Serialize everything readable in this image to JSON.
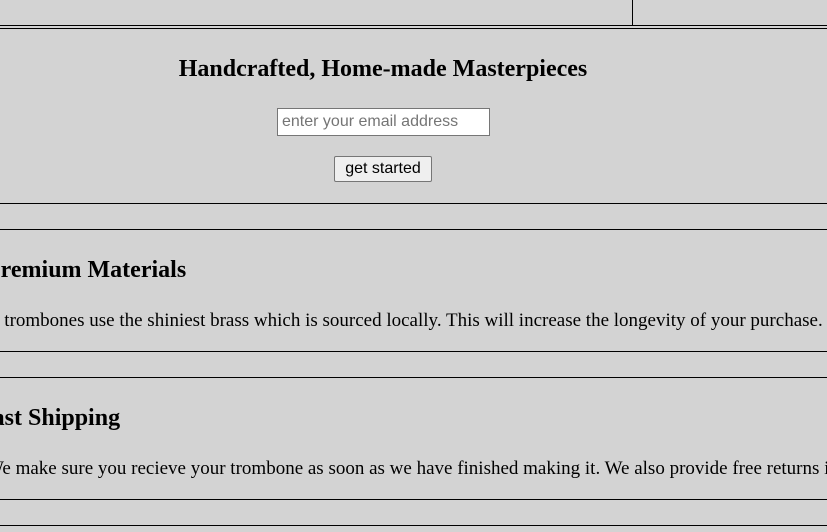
{
  "hero": {
    "title": "Handcrafted, Home-made Masterpieces",
    "email_placeholder": "enter your email address",
    "button_label": "get started"
  },
  "features": [
    {
      "heading": "Premium Materials",
      "text": "Our trombones use the shiniest brass which is sourced locally. This will increase the longevity of your purchase."
    },
    {
      "heading": "Fast Shipping",
      "text": "We make sure you recieve your trombone as soon as we have finished making it. We also provide free returns if you are not satisfied."
    }
  ]
}
